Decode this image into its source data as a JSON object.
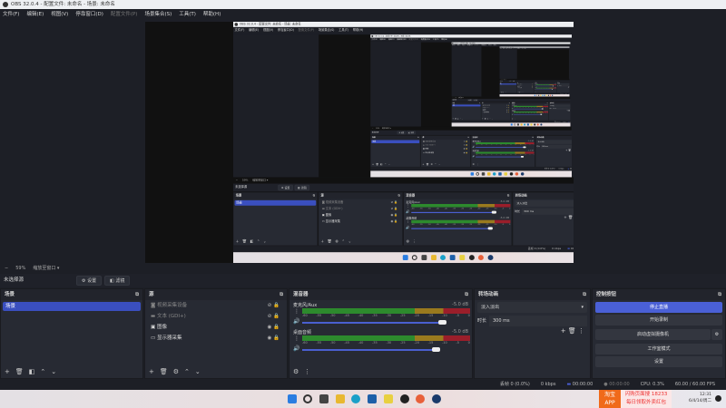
{
  "window": {
    "title": "OBS 32.0.4 - 配置文件: 未命名 - 场景: 未命名"
  },
  "menu": [
    "文件(F)",
    "编辑(E)",
    "视图(V)",
    "停靠窗口(D)",
    "配置文件(P)",
    "场景集合(S)",
    "工具(T)",
    "帮助(H)"
  ],
  "zoom": {
    "minus": "−",
    "value": "59%",
    "mode": "缩放至窗口"
  },
  "source_bar": {
    "label": "未选择源",
    "settings": "设置",
    "filters": "滤镜"
  },
  "scenes": {
    "title": "场景",
    "items": [
      "场景"
    ]
  },
  "sources": {
    "title": "源",
    "items": [
      {
        "name": "视频采集设备",
        "visible": false,
        "icon": "camera-icon"
      },
      {
        "name": "文本 (GDI+)",
        "visible": false,
        "icon": "text-icon"
      },
      {
        "name": "图像",
        "visible": true,
        "icon": "image-icon"
      },
      {
        "name": "显示器采集",
        "visible": true,
        "icon": "monitor-icon"
      }
    ]
  },
  "mixer": {
    "title": "混音器",
    "ticks": [
      "-60",
      "-55",
      "-50",
      "-45",
      "-40",
      "-35",
      "-30",
      "-25",
      "-20",
      "-15",
      "-10",
      "-5",
      "0"
    ],
    "channels": [
      {
        "name": "麦克风/Aux",
        "db": "-5.0 dB",
        "volume": 0.9
      },
      {
        "name": "桌面音频",
        "db": "-5.0 dB",
        "volume": 0.86
      }
    ]
  },
  "transitions": {
    "title": "转场动画",
    "selected": "淡入淡出",
    "duration_label": "时长",
    "duration": "300 ms"
  },
  "controls": {
    "title": "控制按钮",
    "buttons": [
      "停止直播",
      "开始录制",
      "启动虚拟摄像机",
      "工作室模式",
      "设置"
    ]
  },
  "status": {
    "dropped": "丢帧 0 (0.0%)",
    "bitrate": "0 kbps",
    "stream_time": "00:00:00",
    "rec_time": "00:00:00",
    "cpu": "CPU: 0.3%",
    "fps": "60.00 / 60.00 FPS"
  },
  "taskbar": {
    "ad_app": "淘宝 APP",
    "ad_line1": "闪购页面搜 18233",
    "ad_line2": "每日领取外卖红包",
    "time": "12:31",
    "date": "6/4/14/周二"
  },
  "colors": {
    "accent": "#4a60d6",
    "bg": "#1d1f26",
    "panel": "#272a33"
  }
}
